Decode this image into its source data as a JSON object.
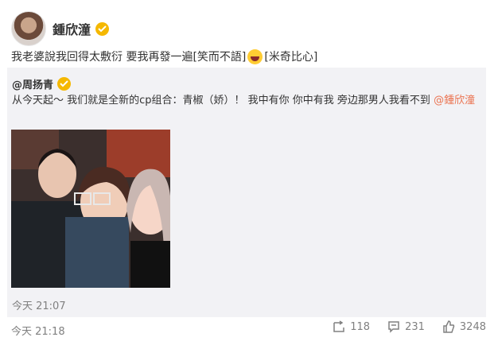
{
  "post": {
    "author": "鍾欣潼",
    "text_before_emoji": "我老婆說我回得太敷衍 要我再發一遍[笑而不語]",
    "text_after_emoji": "[米奇比心]",
    "time": "今天 21:18",
    "counts": {
      "repost": "118",
      "comment": "231",
      "like": "3248"
    }
  },
  "repost": {
    "author": "@周扬青",
    "text": "从今天起～ 我们就是全新的cp组合：青椒（娇）！ 我中有你 你中有我 旁边那男人我看不到",
    "mention": "@鍾欣潼",
    "time": "今天 21:07"
  },
  "colors": {
    "accent": "#eb7350",
    "muted": "#808080",
    "badge": "#f5b800",
    "repost_bg": "#f2f2f5"
  },
  "icons": [
    "verified-badge-icon",
    "laughing-emoji-icon",
    "repost-icon",
    "comment-icon",
    "like-icon"
  ]
}
